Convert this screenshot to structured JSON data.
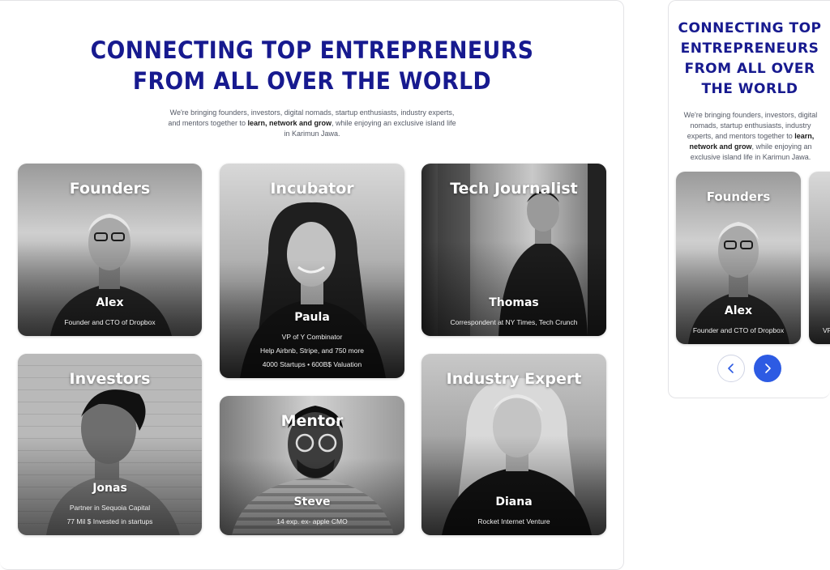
{
  "headline": "CONNECTING TOP ENTREPRENEURS FROM ALL OVER THE WORLD",
  "intro": {
    "before": "We're bringing founders, investors, digital nomads, startup enthusiasts, industry experts, and mentors together to ",
    "bold": "learn, network and grow",
    "after": ", while enjoying an exclusive island life in Karimun Jawa."
  },
  "cards": [
    {
      "role": "Founders",
      "name": "Alex",
      "lines": [
        "Founder and CTO of Dropbox"
      ]
    },
    {
      "role": "Incubator",
      "name": "Paula",
      "lines": [
        "VP of Y Combinator",
        "Help Airbnb, Stripe, and 750 more",
        "4000 Startups • 600B$ Valuation"
      ]
    },
    {
      "role": "Tech Journalist",
      "name": "Thomas",
      "lines": [
        "Correspondent at NY Times, Tech Crunch"
      ]
    },
    {
      "role": "Investors",
      "name": "Jonas",
      "lines": [
        "Partner in Sequoia Capital",
        "77 Mil $ Invested in startups"
      ]
    },
    {
      "role": "Mentor",
      "name": "Steve",
      "lines": [
        "14 exp. ex- apple CMO"
      ]
    },
    {
      "role": "Industry Expert",
      "name": "Diana",
      "lines": [
        "Rocket Internet Venture"
      ]
    }
  ],
  "carousel": {
    "prev_icon": "chevron-left-icon",
    "next_icon": "chevron-right-icon",
    "accent": "#2d5be3"
  },
  "colors": {
    "headline": "#171a8f",
    "body_text": "#555a66"
  }
}
